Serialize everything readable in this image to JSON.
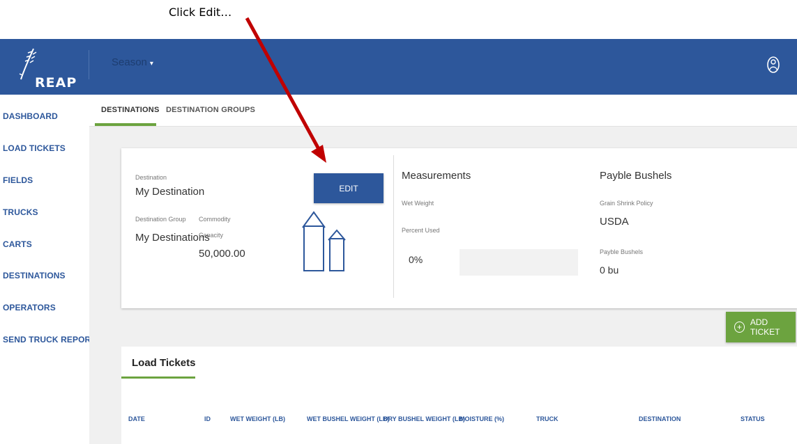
{
  "annotation": {
    "text": "Click Edit…"
  },
  "app": {
    "logo_text": "REAP"
  },
  "topbar": {
    "season_label": "Season",
    "caret": "▾"
  },
  "sidebar": {
    "items": [
      {
        "label": "DASHBOARD"
      },
      {
        "label": "LOAD TICKETS"
      },
      {
        "label": "FIELDS"
      },
      {
        "label": "TRUCKS"
      },
      {
        "label": "CARTS"
      },
      {
        "label": "DESTINATIONS"
      },
      {
        "label": "OPERATORS"
      },
      {
        "label": "SEND TRUCK REPORT"
      }
    ]
  },
  "tabs": [
    {
      "label": "DESTINATIONS",
      "active": true
    },
    {
      "label": "DESTINATION GROUPS",
      "active": false
    }
  ],
  "destination": {
    "destination_label": "Destination",
    "destination_value": "My Destination",
    "group_label": "Destination Group",
    "group_value": "My Destinations",
    "commodity_label": "Commodity",
    "capacity_label": "Capacity",
    "capacity_value": "50,000.00",
    "edit_label": "EDIT"
  },
  "measurements": {
    "title": "Measurements",
    "wet_weight_label": "Wet Weight",
    "percent_used_label": "Percent Used",
    "percent_used_value": "0%",
    "percent_used_fraction": 0
  },
  "payble": {
    "title": "Payble Bushels",
    "policy_label": "Grain Shrink Policy",
    "policy_value": "USDA",
    "bushels_label": "Payble Bushels",
    "bushels_value": "0 bu"
  },
  "actions": {
    "add_ticket_label": "ADD TICKET",
    "plus": "+"
  },
  "load_tickets": {
    "title": "Load Tickets",
    "columns": [
      "DATE",
      "ID",
      "WET WEIGHT (LB)",
      "WET BUSHEL WEIGHT (LB)",
      "DRY BUSHEL WEIGHT (LB)",
      "MOISTURE (%)",
      "TRUCK",
      "DESTINATION",
      "STATUS"
    ]
  },
  "colors": {
    "primary": "#2d579b",
    "accent": "#6ca33f",
    "annotation_arrow": "#c00000"
  }
}
